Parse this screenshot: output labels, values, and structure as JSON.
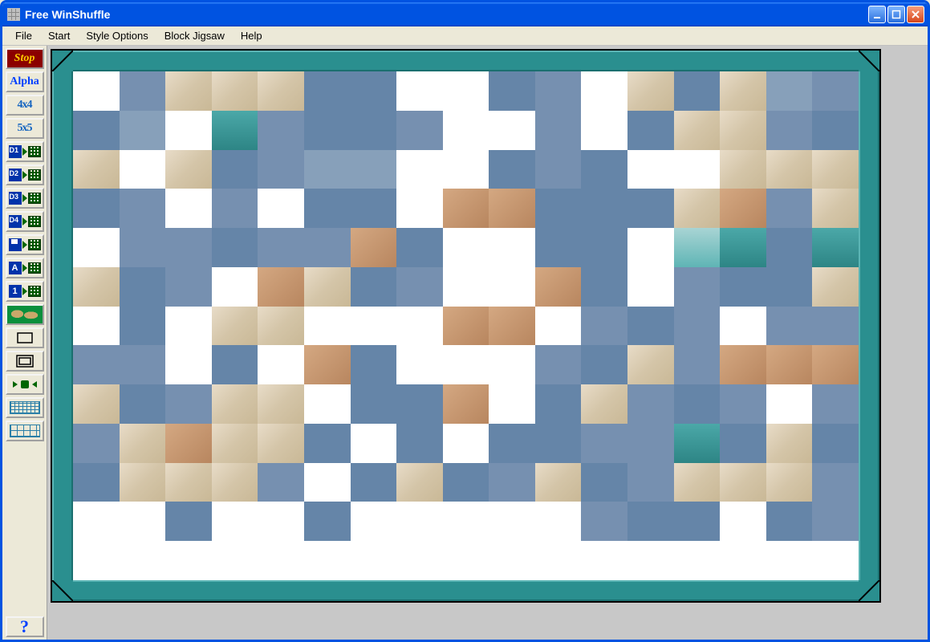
{
  "window": {
    "title": "Free WinShuffle"
  },
  "menubar": {
    "items": [
      "File",
      "Start",
      "Style Options",
      "Block Jigsaw",
      "Help"
    ]
  },
  "toolbar": {
    "stop": "Stop",
    "alpha": "Alpha",
    "grid44": "4x4",
    "grid55": "5x5",
    "d1": "D1",
    "d2": "D2",
    "d3": "D3",
    "d4": "D4",
    "save": "",
    "lettergrid": "A",
    "numgrid": "1",
    "help": "?"
  },
  "colors": {
    "titlebar": "#0053e1",
    "stop_bg": "#8b0000",
    "stop_fg": "#ffcc00",
    "teal_frame": "#2a8f8f",
    "desktop": "#c8c8c8"
  },
  "puzzle": {
    "cols": 17,
    "rows": 13,
    "tile_classes": [
      "t-white",
      "t-sky1",
      "t-sand",
      "t-sand",
      "t-sand",
      "t-sky2",
      "t-sky2",
      "t-white",
      "t-white",
      "t-sky2",
      "t-sky1",
      "t-white",
      "t-sand",
      "t-sky2",
      "t-sand",
      "t-sky3",
      "t-sky1",
      "t-sky2",
      "t-sky3",
      "t-white",
      "t-sea",
      "t-sky1",
      "t-sky2",
      "t-sky2",
      "t-sky1",
      "t-white",
      "t-white",
      "t-sky1",
      "t-white",
      "t-sky2",
      "t-sand",
      "t-sand",
      "t-sky1",
      "t-sky2",
      "t-sand",
      "t-white",
      "t-sand",
      "t-sky2",
      "t-sky1",
      "t-sky3",
      "t-sky3",
      "t-white",
      "t-white",
      "t-sky2",
      "t-sky1",
      "t-sky2",
      "t-white",
      "t-white",
      "t-sand",
      "t-sand",
      "t-sand",
      "t-sky2",
      "t-sky1",
      "t-white",
      "t-sky1",
      "t-white",
      "t-sky2",
      "t-sky2",
      "t-white",
      "t-skin",
      "t-skin",
      "t-sky2",
      "t-sky2",
      "t-sky2",
      "t-sand",
      "t-skin",
      "t-sky1",
      "t-sand",
      "t-white",
      "t-sky1",
      "t-sky1",
      "t-sky2",
      "t-sky1",
      "t-sky1",
      "t-skin",
      "t-sky2",
      "t-white",
      "t-white",
      "t-sky2",
      "t-sky2",
      "t-white",
      "t-seaL",
      "t-sea",
      "t-sky2",
      "t-sea",
      "t-sand",
      "t-sky2",
      "t-sky1",
      "t-white",
      "t-skin",
      "t-sand",
      "t-sky2",
      "t-sky1",
      "t-white",
      "t-white",
      "t-skin",
      "t-sky2",
      "t-white",
      "t-sky1",
      "t-sky2",
      "t-sky2",
      "t-sand",
      "t-white",
      "t-sky2",
      "t-white",
      "t-sand",
      "t-sand",
      "t-white",
      "t-white",
      "t-white",
      "t-skin",
      "t-skin",
      "t-white",
      "t-sky1",
      "t-sky2",
      "t-sky1",
      "t-white",
      "t-sky1",
      "t-sky1",
      "t-sky1",
      "t-sky1",
      "t-white",
      "t-sky2",
      "t-white",
      "t-skin",
      "t-sky2",
      "t-white",
      "t-white",
      "t-white",
      "t-sky1",
      "t-sky2",
      "t-sand",
      "t-sky1",
      "t-skin",
      "t-skin",
      "t-skin",
      "t-sand",
      "t-sky2",
      "t-sky1",
      "t-sand",
      "t-sand",
      "t-white",
      "t-sky2",
      "t-sky2",
      "t-skin",
      "t-white",
      "t-sky2",
      "t-sand",
      "t-sky1",
      "t-sky2",
      "t-sky1",
      "t-white",
      "t-sky1",
      "t-sky1",
      "t-sand",
      "t-skin",
      "t-sand",
      "t-sand",
      "t-sky2",
      "t-white",
      "t-sky2",
      "t-white",
      "t-sky2",
      "t-sky2",
      "t-sky1",
      "t-sky1",
      "t-sea",
      "t-sky2",
      "t-sand",
      "t-sky2",
      "t-sky2",
      "t-sand",
      "t-sand",
      "t-sand",
      "t-sky1",
      "t-white",
      "t-sky2",
      "t-sand",
      "t-sky2",
      "t-sky1",
      "t-sand",
      "t-sky2",
      "t-sky1",
      "t-sand",
      "t-sand",
      "t-sand",
      "t-sky1",
      "t-white",
      "t-white",
      "t-sky2",
      "t-white",
      "t-white",
      "t-sky2",
      "t-white",
      "t-white",
      "t-white",
      "t-white",
      "t-white",
      "t-sky1",
      "t-sky2",
      "t-sky2",
      "t-white",
      "t-sky2",
      "t-sky1",
      "t-white",
      "t-white",
      "t-white",
      "t-white",
      "t-white",
      "t-white",
      "t-white",
      "t-white",
      "t-white",
      "t-white",
      "t-white",
      "t-white",
      "t-white",
      "t-white",
      "t-white",
      "t-white",
      "t-white"
    ]
  }
}
